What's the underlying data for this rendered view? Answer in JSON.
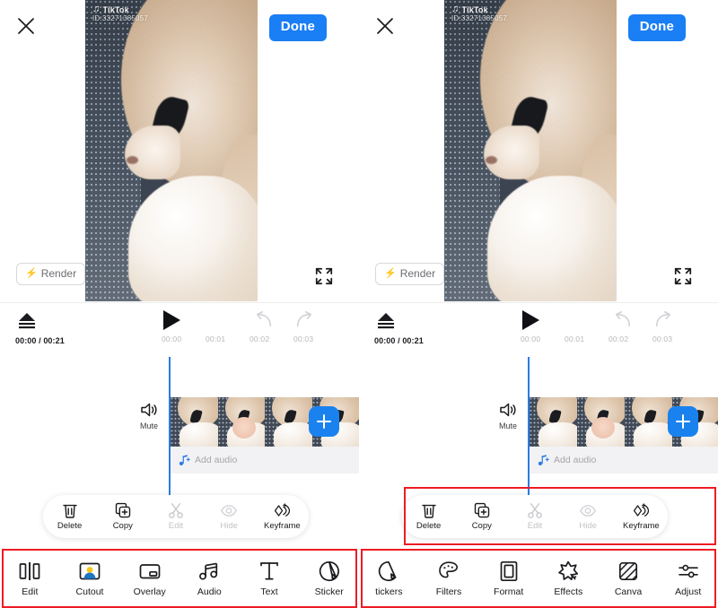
{
  "app": {
    "close_icon": "close-icon",
    "done_label": "Done",
    "render_label": "Render",
    "render_icon": "lightning-bolt-icon",
    "expand_icon": "fullscreen-expand-icon"
  },
  "video": {
    "watermark_brand": "TikTok",
    "watermark_id": "ID:33271385057",
    "watermark_icon": "tiktok-note-icon"
  },
  "transport": {
    "eject_icon": "eject-icon",
    "play_icon": "play-icon",
    "undo_icon": "undo-arrow-icon",
    "redo_icon": "redo-arrow-icon",
    "time_readout": "00:00 / 00:21",
    "ruler_ticks": [
      "00:00",
      "00:01",
      "00:02",
      "00:03"
    ]
  },
  "timeline": {
    "mute_label": "Mute",
    "mute_icon": "speaker-icon",
    "add_audio_label": "Add audio",
    "add_audio_icon": "music-note-plus-icon",
    "add_clip_icon": "plus-icon"
  },
  "context_toolbar": {
    "items": [
      {
        "label": "Delete",
        "icon": "trash-icon",
        "disabled": false
      },
      {
        "label": "Copy",
        "icon": "copy-icon",
        "disabled": false
      },
      {
        "label": "Edit",
        "icon": "scissors-icon",
        "disabled": true
      },
      {
        "label": "Hide",
        "icon": "eye-icon",
        "disabled": true
      },
      {
        "label": "Keyframe",
        "icon": "keyframe-icon",
        "disabled": false
      }
    ]
  },
  "bottom_toolbar_left": {
    "items": [
      {
        "label": "Edit",
        "icon": "split-clip-icon"
      },
      {
        "label": "Cutout",
        "icon": "person-cutout-icon"
      },
      {
        "label": "Overlay",
        "icon": "overlay-rect-icon"
      },
      {
        "label": "Audio",
        "icon": "music-note-icon"
      },
      {
        "label": "Text",
        "icon": "text-t-icon"
      },
      {
        "label": "Sticker",
        "icon": "sticker-icon"
      }
    ]
  },
  "bottom_toolbar_right": {
    "items": [
      {
        "label": "tickers",
        "icon": "sticker-icon"
      },
      {
        "label": "Filters",
        "icon": "palette-icon"
      },
      {
        "label": "Format",
        "icon": "format-frame-icon"
      },
      {
        "label": "Effects",
        "icon": "sparkle-star-icon"
      },
      {
        "label": "Canva",
        "icon": "canvas-hatch-icon"
      },
      {
        "label": "Adjust",
        "icon": "sliders-icon"
      }
    ]
  },
  "colors": {
    "accent_blue": "#1a7ef5",
    "playhead_blue": "#2c7be5",
    "annotation_red": "#ee1c24",
    "disabled_gray": "#c3c3c8"
  }
}
